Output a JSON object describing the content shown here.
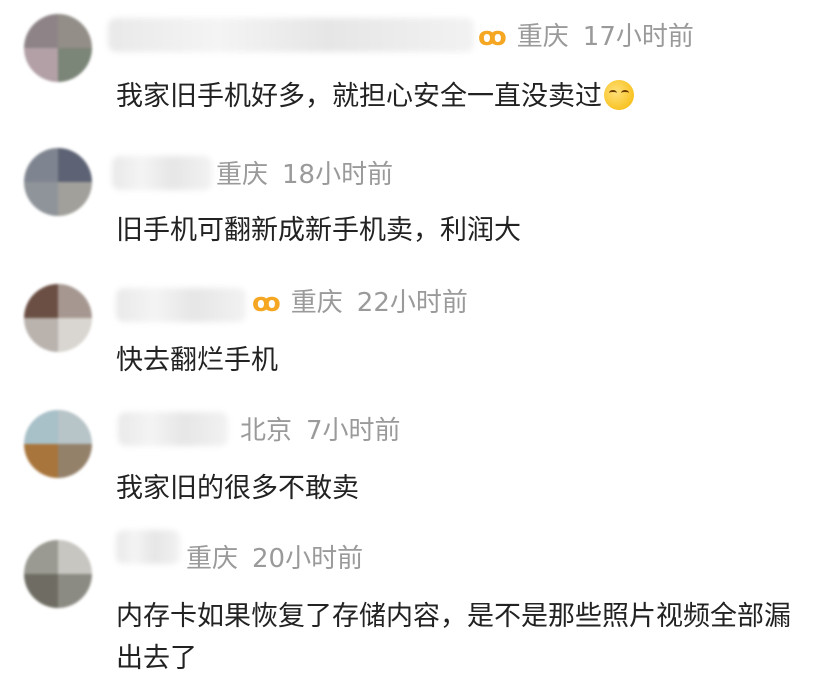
{
  "comments": [
    {
      "avatar_colors": [
        "#8e8487",
        "#938e88",
        "#b2a0a6",
        "#7b8578"
      ],
      "badge": "ꝏ",
      "location": "重庆",
      "time": "17小时前",
      "text": "我家旧手机好多，就担心安全一直没卖过",
      "emoji": "laughing-crying-emoji"
    },
    {
      "avatar_colors": [
        "#7f8590",
        "#5d6374",
        "#8f949a",
        "#a1a09b"
      ],
      "badge": "",
      "location": "重庆",
      "time": "18小时前",
      "text": "旧手机可翻新成新手机卖，利润大"
    },
    {
      "avatar_colors": [
        "#6b4f44",
        "#a69891",
        "#b9b2ad",
        "#d9d5d0"
      ],
      "badge": "ꝏ",
      "location": "重庆",
      "time": "22小时前",
      "text": "快去翻烂手机"
    },
    {
      "avatar_colors": [
        "#a8c0c8",
        "#b7c4c8",
        "#a8753c",
        "#94816a"
      ],
      "badge": "",
      "location": "北京",
      "time": "7小时前",
      "text": "我家旧的很多不敢卖"
    },
    {
      "avatar_colors": [
        "#9a9a92",
        "#c8c6c1",
        "#6f6d63",
        "#8c8b83"
      ],
      "badge": "",
      "location": "重庆",
      "time": "20小时前",
      "text": "内存卡如果恢复了存储内容，是不是那些照片视频全部漏出去了"
    }
  ]
}
